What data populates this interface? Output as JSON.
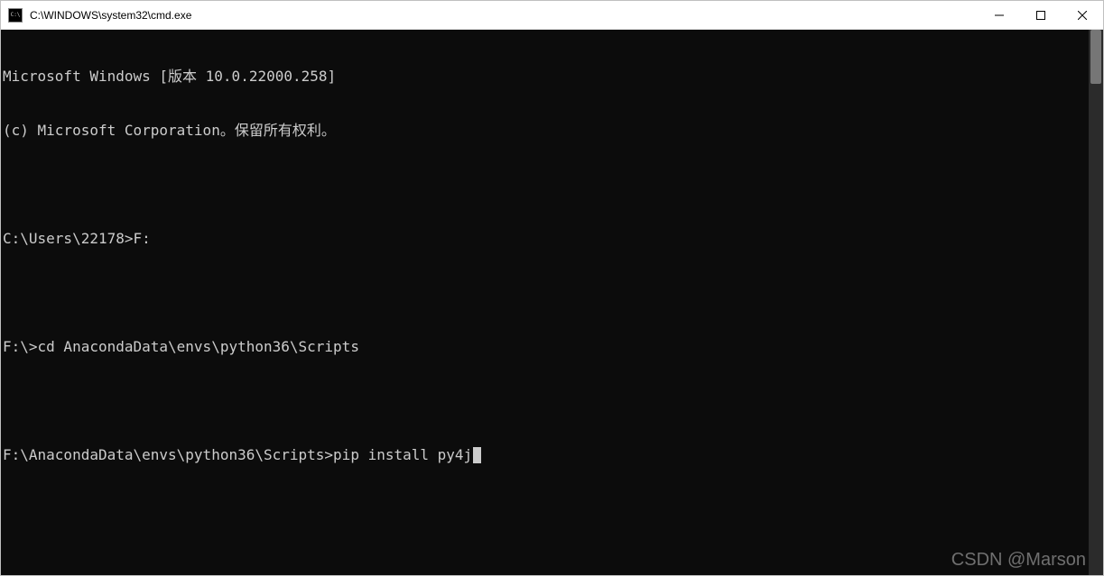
{
  "window": {
    "title": "C:\\WINDOWS\\system32\\cmd.exe"
  },
  "terminal": {
    "lines": [
      "Microsoft Windows [版本 10.0.22000.258]",
      "(c) Microsoft Corporation。保留所有权利。",
      "",
      "C:\\Users\\22178>F:",
      "",
      "F:\\>cd AnacondaData\\envs\\python36\\Scripts",
      "",
      "F:\\AnacondaData\\envs\\python36\\Scripts>pip install py4j"
    ]
  },
  "watermark": "CSDN @Marson"
}
